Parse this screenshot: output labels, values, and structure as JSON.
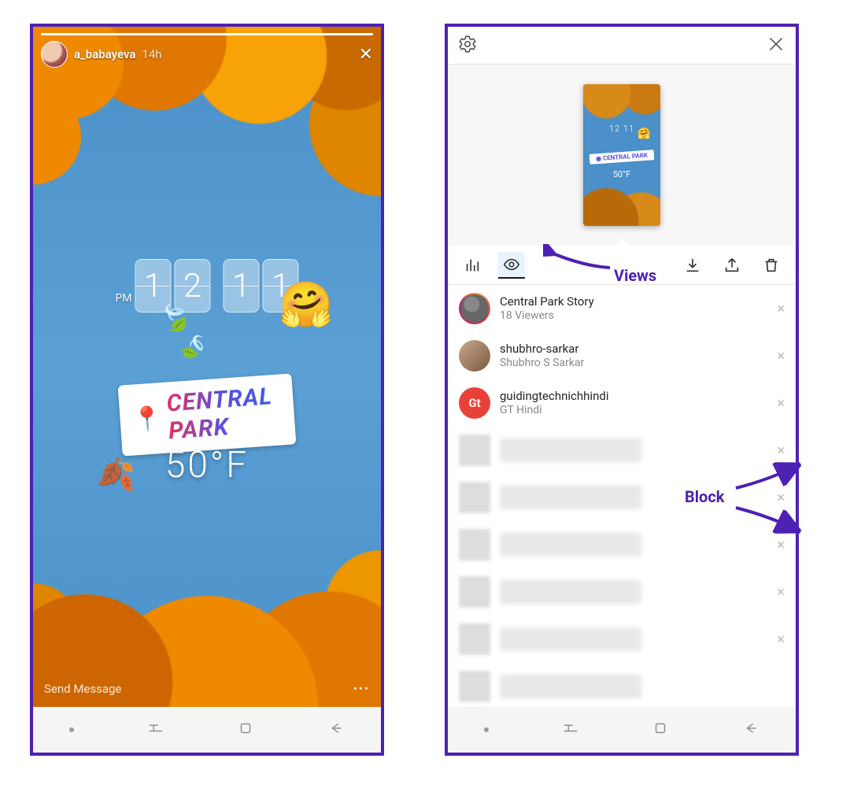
{
  "left_story": {
    "username": "a_babayeva",
    "timestamp": "14h",
    "clock_pm": "PM",
    "clock_digits": [
      "1",
      "2",
      "1",
      "1"
    ],
    "location_text": "CENTRAL PARK",
    "temperature": "50°F",
    "send_placeholder": "Send Message",
    "emoji_hug": "🤗",
    "emoji_leaf_green": "🍃",
    "emoji_leaf_fall": "🍂"
  },
  "right_viewers": {
    "thumb_clock": "12 11",
    "thumb_location": "CENTRAL PARK",
    "thumb_temp": "50°F",
    "header": {
      "title": "Central Park Story",
      "viewers_count": "18 Viewers"
    },
    "viewers": [
      {
        "username": "shubhro-sarkar",
        "name": "Shubhro S Sarkar"
      },
      {
        "username": "guidingtechnichhindi",
        "name": "GT Hindi",
        "avatar_text": "Gt"
      }
    ]
  },
  "annotations": {
    "views": "Views",
    "block": "Block"
  }
}
